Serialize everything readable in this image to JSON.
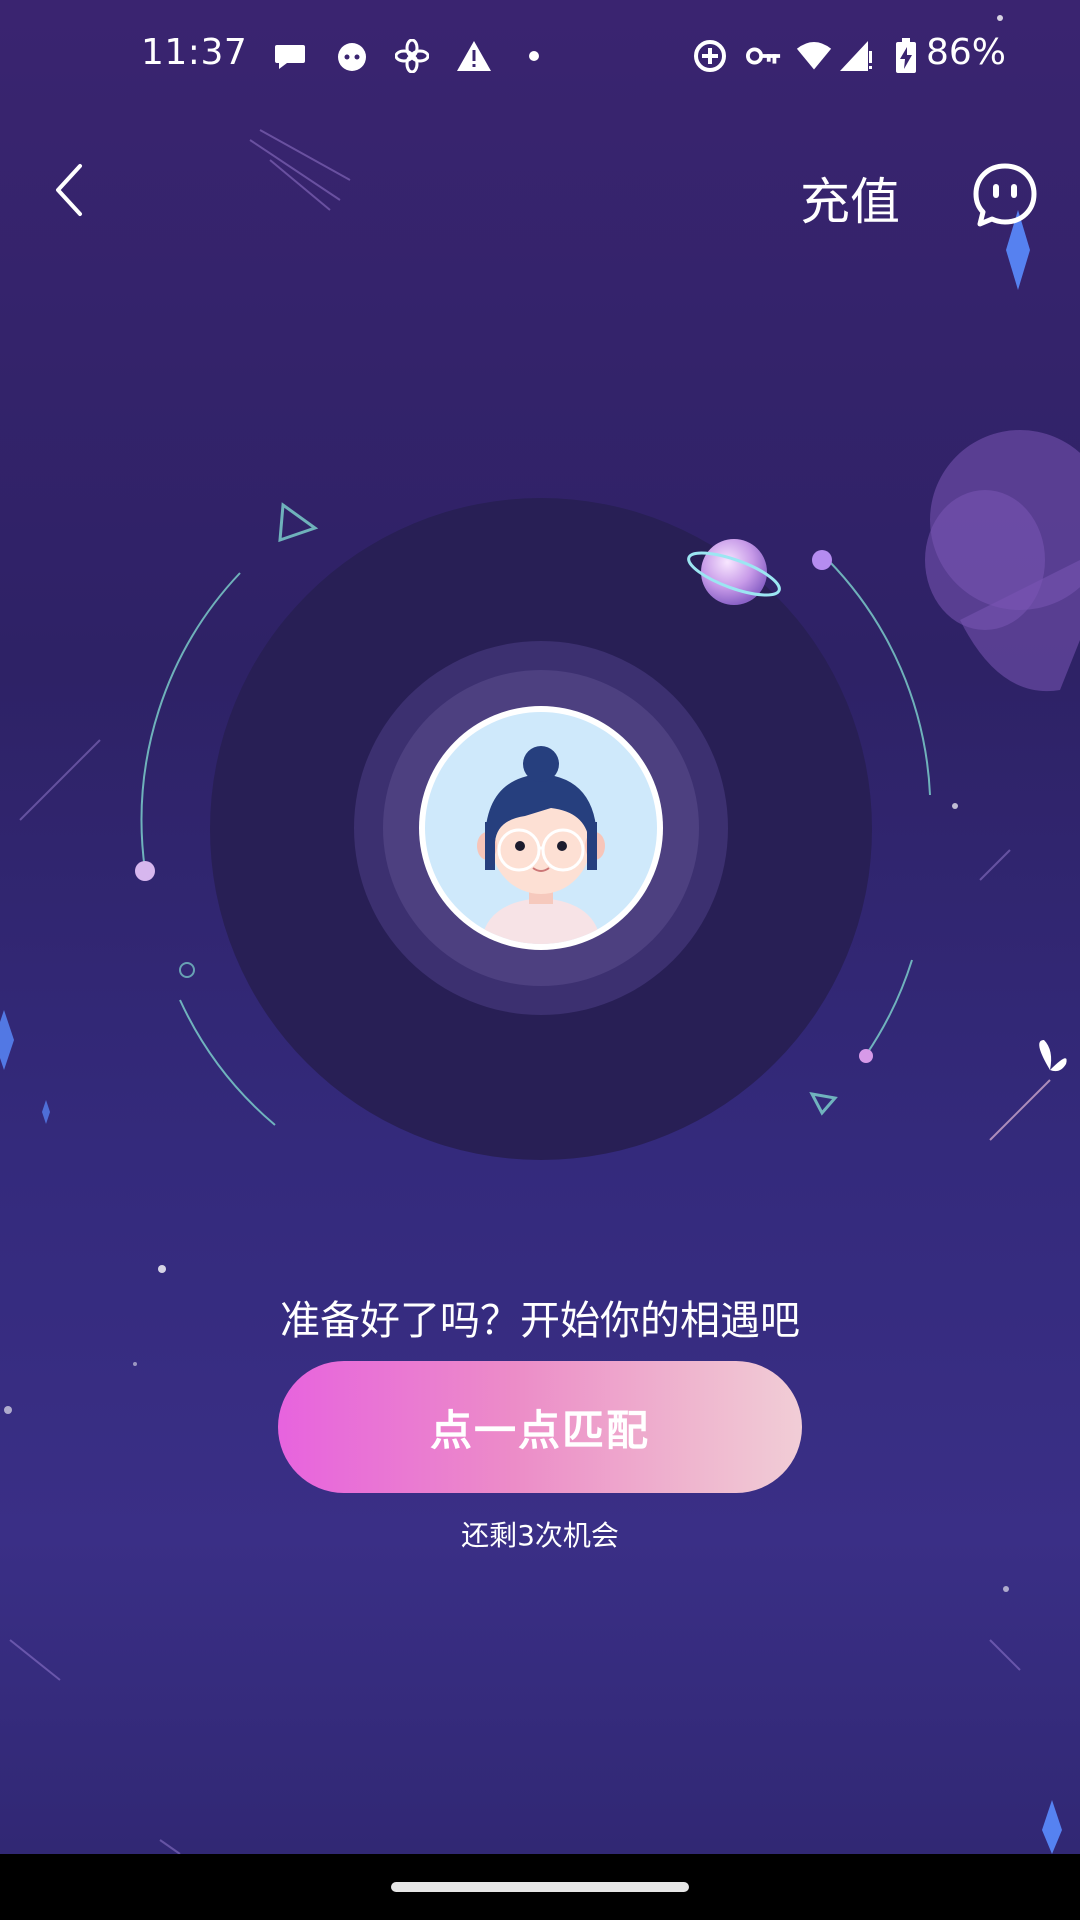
{
  "status_bar": {
    "time": "11:37",
    "battery": "86%",
    "icons": [
      "chat-bubble-icon",
      "cat-icon",
      "fan-icon",
      "warning-icon",
      "dot-icon",
      "data-saver-icon",
      "vpn-key-icon",
      "wifi-icon",
      "signal-icon",
      "battery-charging-icon"
    ]
  },
  "header": {
    "back_icon": "back-chevron-icon",
    "recharge_label": "充值",
    "chat_icon": "chat-face-icon"
  },
  "main": {
    "prompt": "准备好了吗？开始你的相遇吧",
    "match_button_label": "点一点匹配",
    "chances_label": "还剩3次机会"
  },
  "colors": {
    "button_gradient_start": "#e763de",
    "button_gradient_end": "#f1cdd6",
    "disc": "#281f55",
    "background": "#2e2266"
  }
}
